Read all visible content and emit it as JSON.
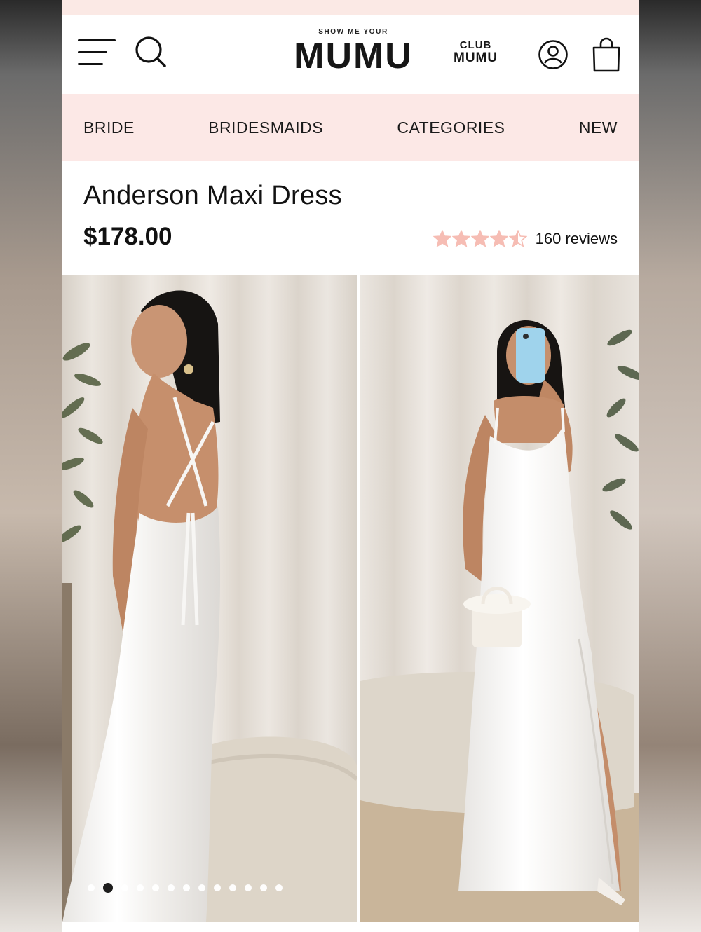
{
  "brand": {
    "tagline": "SHOW ME YOUR",
    "name": "MUMU",
    "club_line1": "CLUB",
    "club_line2": "MUMU"
  },
  "nav": {
    "items": [
      {
        "label": "BRIDE"
      },
      {
        "label": "BRIDESMAIDS"
      },
      {
        "label": "CATEGORIES"
      },
      {
        "label": "NEW"
      }
    ]
  },
  "product": {
    "title": "Anderson Maxi Dress",
    "price": "$178.00",
    "rating": 4.5,
    "rating_max": 5,
    "reviews_label": "160 reviews"
  },
  "gallery": {
    "photos": [
      {
        "icon": "model-back-view-image"
      },
      {
        "icon": "model-front-mirror-selfie-image"
      }
    ],
    "dot_count": 13,
    "active_dot": 1
  },
  "colors": {
    "nav_bg": "#fce8e6",
    "star": "#f6bdb4",
    "text": "#111111"
  }
}
